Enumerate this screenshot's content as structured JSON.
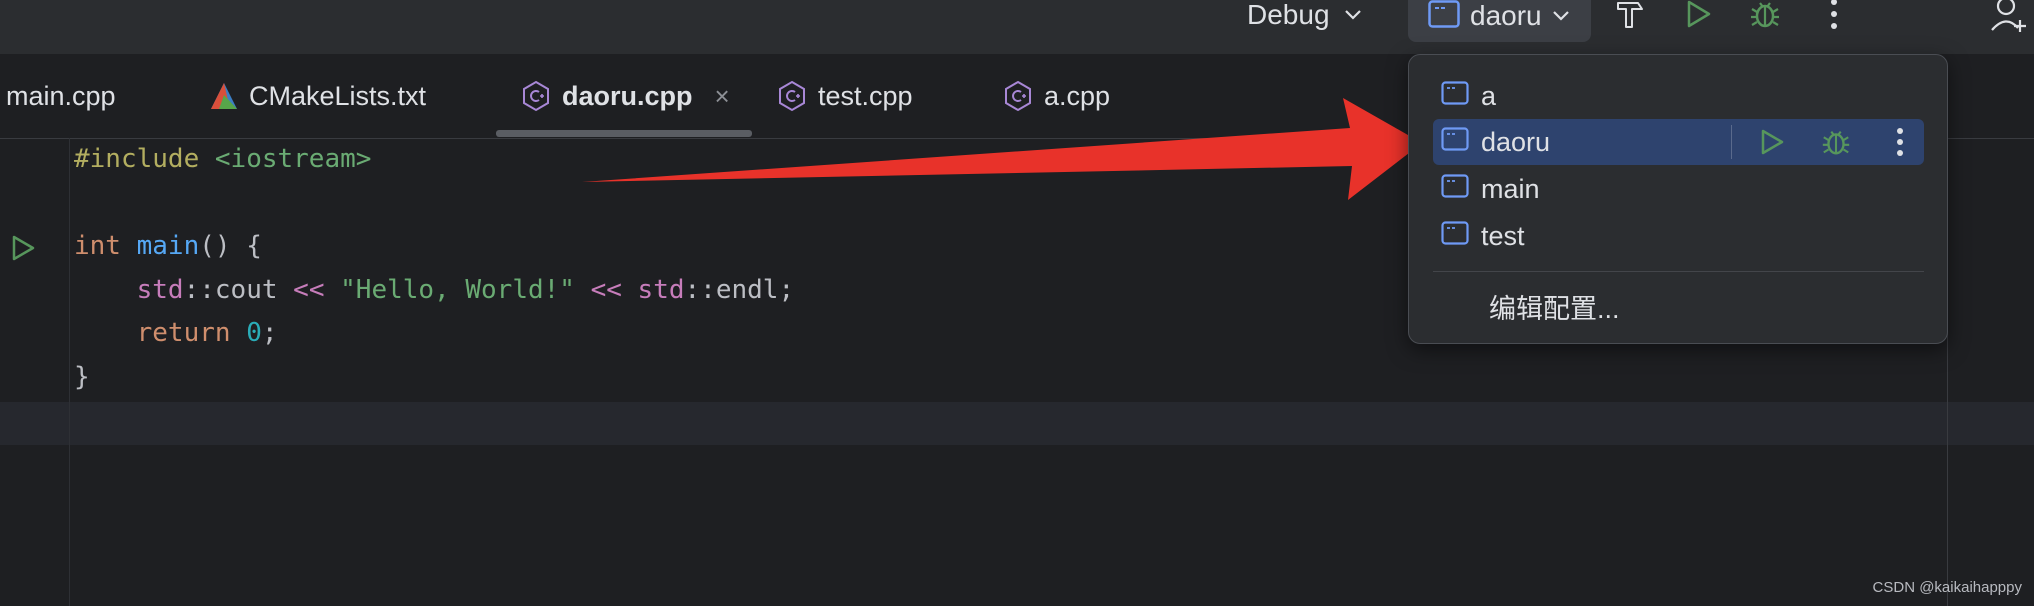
{
  "toolbar": {
    "build_config": "Debug",
    "run_config": "daoru",
    "icons": [
      "chevron-down-icon",
      "config-icon",
      "hammer-icon",
      "run-icon",
      "debug-icon",
      "more-icon",
      "add-user-icon"
    ]
  },
  "tabs": [
    {
      "label": "main.cpp",
      "icon": "",
      "active": false
    },
    {
      "label": "CMakeLists.txt",
      "icon": "cmake-icon",
      "active": false
    },
    {
      "label": "daoru.cpp",
      "icon": "cpp-file-icon",
      "active": true,
      "close": "×"
    },
    {
      "label": "test.cpp",
      "icon": "cpp-file-icon",
      "active": false
    },
    {
      "label": "a.cpp",
      "icon": "cpp-file-icon",
      "active": false
    }
  ],
  "code": {
    "l1_pp": "#include",
    "l1_inc": " <iostream>",
    "l3_kw": "int",
    "l3_fn": "main",
    "l3_rest": "() {",
    "l4_indent": "    ",
    "l4_ns1": "std",
    "l4_a": "::cout ",
    "l4_op1": "<<",
    "l4_str": " \"Hello, World!\" ",
    "l4_op2": "<<",
    "l4_ns2": " std",
    "l4_b": "::endl;",
    "l5_kw": "return",
    "l5_num": " 0",
    "l5_semi": ";",
    "l6": "}"
  },
  "popup": {
    "items": [
      {
        "label": "a",
        "selected": false
      },
      {
        "label": "daoru",
        "selected": true
      },
      {
        "label": "main",
        "selected": false
      },
      {
        "label": "test",
        "selected": false
      }
    ],
    "edit_label": "编辑配置..."
  },
  "colors": {
    "accent": "#2e436e",
    "arrow": "#e8322a",
    "run": "#57965c"
  },
  "watermark": "CSDN @kaikaihapppy"
}
